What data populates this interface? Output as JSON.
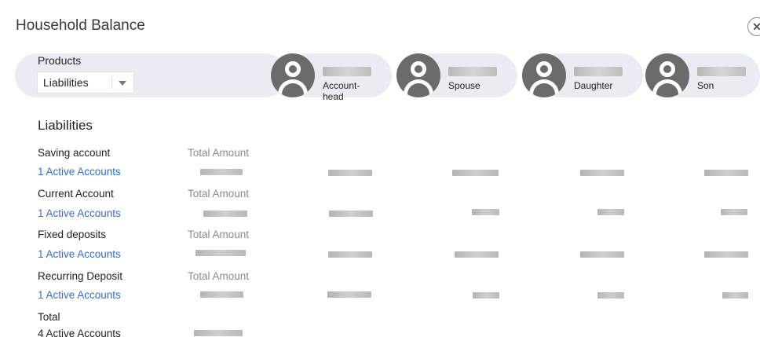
{
  "header": {
    "title": "Household Balance",
    "close_icon": "close-icon"
  },
  "products": {
    "label": "Products",
    "selected": "Liabilities"
  },
  "members": [
    {
      "role": "Account-head"
    },
    {
      "role": "Spouse"
    },
    {
      "role": "Daughter"
    },
    {
      "role": "Son"
    }
  ],
  "section": {
    "title": "Liabilities"
  },
  "rows": [
    {
      "name": "Saving account",
      "link": "1 Active Accounts",
      "total_label": "Total Amount"
    },
    {
      "name": "Current Account",
      "link": "1 Active Accounts",
      "total_label": "Total Amount"
    },
    {
      "name": "Fixed deposits",
      "link": "1 Active Accounts",
      "total_label": "Total Amount"
    },
    {
      "name": "Recurring Deposit",
      "link": "1 Active Accounts",
      "total_label": "Total Amount"
    }
  ],
  "total": {
    "label": "Total",
    "accounts": "4 Active Accounts"
  },
  "colors": {
    "link": "#2f6fd6",
    "pill": "#e9edf3",
    "avatar": "#6b6b6b"
  }
}
